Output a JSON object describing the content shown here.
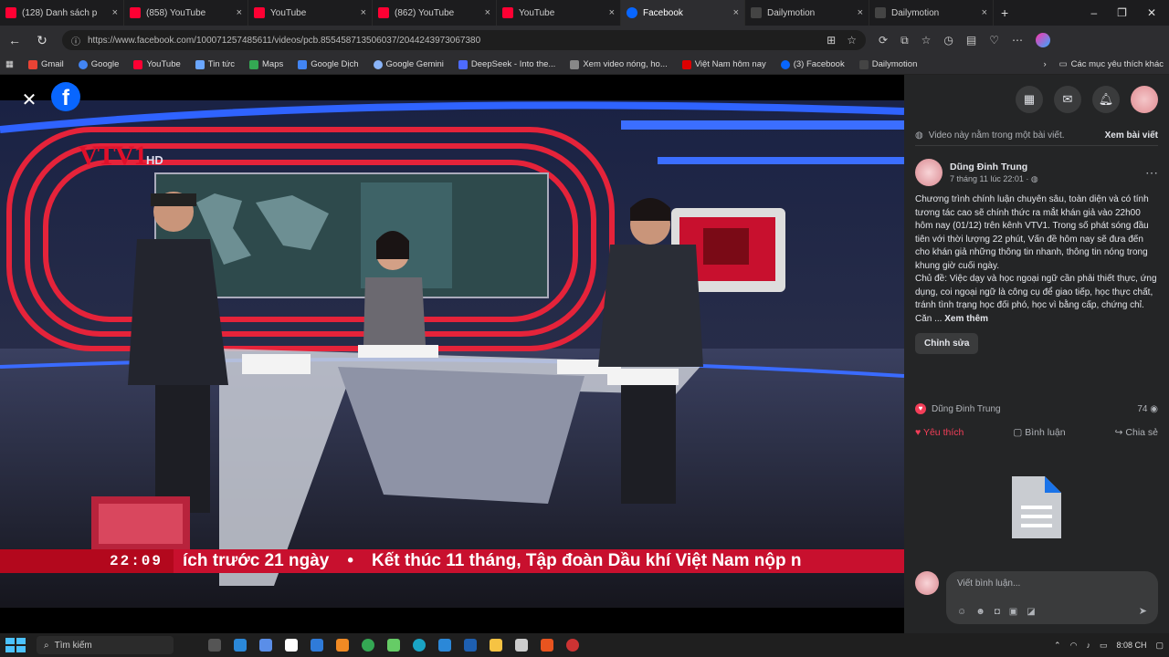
{
  "tabs": [
    {
      "title": "(128) Danh sách p",
      "color": "#ff0033"
    },
    {
      "title": "(858) YouTube",
      "color": "#ff0033"
    },
    {
      "title": "YouTube",
      "color": "#ff0033"
    },
    {
      "title": "(862) YouTube",
      "color": "#ff0033"
    },
    {
      "title": "YouTube",
      "color": "#ff0033"
    },
    {
      "title": "Facebook",
      "color": "#0866ff"
    },
    {
      "title": "Dailymotion",
      "color": "#444"
    },
    {
      "title": "Dailymotion",
      "color": "#444"
    }
  ],
  "address": {
    "url": "https://www.facebook.com/100071257485611/videos/pcb.855458713506037/2044243973067380"
  },
  "bookmarks": [
    "Gmail",
    "Google",
    "YouTube",
    "Tin tức",
    "Maps",
    "Google Dịch",
    "Google Gemini",
    "DeepSeek - Into the...",
    "Xem video nóng, ho...",
    "Việt Nam hôm nay",
    "(3) Facebook",
    "Dailymotion"
  ],
  "bookmarks_end": "Các mục yêu thích khác",
  "video": {
    "channel": "VTV1",
    "hd": "HD",
    "clock": "22:09",
    "ticker_left": "ích trước 21 ngày",
    "ticker_right": "Kết thúc 11 tháng, Tập đoàn Dầu khí Việt Nam nộp n"
  },
  "sidebar": {
    "note": "Video này nằm trong một bài viết.",
    "see_post": "Xem bài viết",
    "author": "Dũng Đinh Trung",
    "time": "7 tháng 11 lúc 22:01 · ",
    "text": "Chương trình chính luận chuyên sâu, toàn diện và có tính tương tác cao sẽ chính thức ra mắt khán giả vào 22h00 hôm nay (01/12) trên kênh VTV1. Trong số phát sóng đầu tiên với thời lượng 22 phút, Vấn đề hôm nay sẽ đưa đến cho khán giả những thông tin nhanh, thông tin nóng trong khung giờ cuối ngày.\nChủ đề: Việc dạy và học ngoại ngữ cần phải thiết thực, ứng dụng, coi ngoại ngữ là công cụ để giao tiếp, học thực chất, tránh tình trạng học đối phó, học vì bằng cấp, chứng chỉ. Căn ...",
    "see_more": "Xem thêm",
    "edit": "Chỉnh sửa",
    "reactor": "Dũng Đinh Trung",
    "views": "74",
    "like": "Yêu thích",
    "comment": "Bình luận",
    "share": "Chia sẻ",
    "comment_placeholder": "Viết bình luận..."
  },
  "taskbar": {
    "search": "Tìm kiếm",
    "time": "8:08 CH"
  }
}
